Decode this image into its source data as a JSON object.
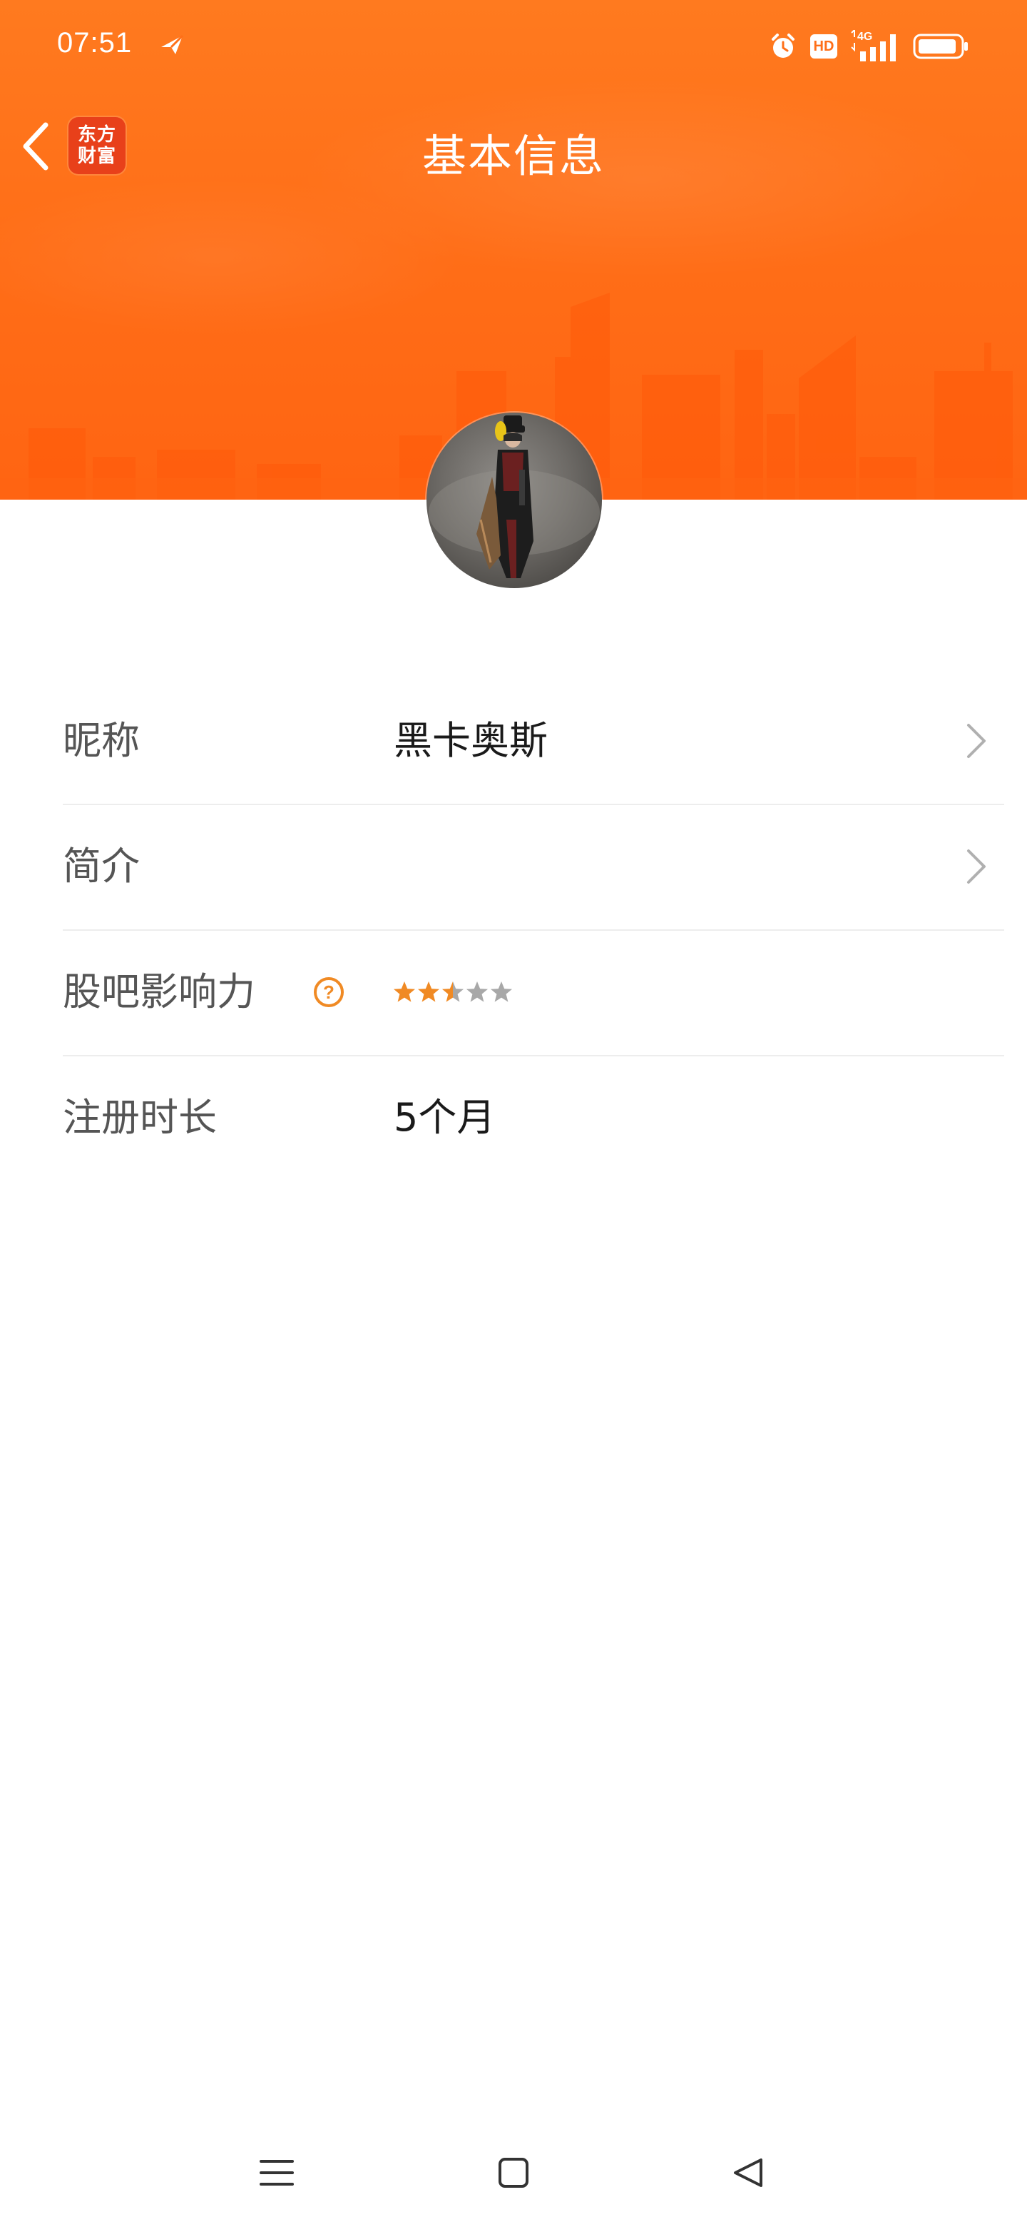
{
  "status_bar": {
    "time": "07:51",
    "hd_label": "HD",
    "network_label": "4G",
    "icons": [
      "send-icon",
      "alarm-icon",
      "hd-icon",
      "signal-icon",
      "battery-icon"
    ]
  },
  "nav": {
    "back_icon": "chevron-left-icon",
    "app_logo_line1": "东方",
    "app_logo_line2": "财富",
    "title": "基本信息"
  },
  "profile": {
    "avatar_icon": "avatar-image"
  },
  "info_rows": [
    {
      "label": "昵称",
      "value": "黑卡奥斯",
      "has_chevron": true
    },
    {
      "label": "简介",
      "value": "",
      "has_chevron": true
    },
    {
      "label": "股吧影响力",
      "rating": 2.5,
      "max_rating": 5,
      "help_icon": "question-circle-icon"
    },
    {
      "label": "注册时长",
      "value": "5个月"
    }
  ],
  "system_nav": {
    "icons": [
      "menu-icon",
      "home-square-icon",
      "back-triangle-icon"
    ]
  },
  "colors": {
    "header_orange": "#ff6f18",
    "star_filled": "#f08a24",
    "star_empty": "#a8a8a8",
    "help_icon": "#f08a24",
    "divider": "#ededed",
    "label_text": "#555555",
    "value_text": "#1a1a1a"
  }
}
